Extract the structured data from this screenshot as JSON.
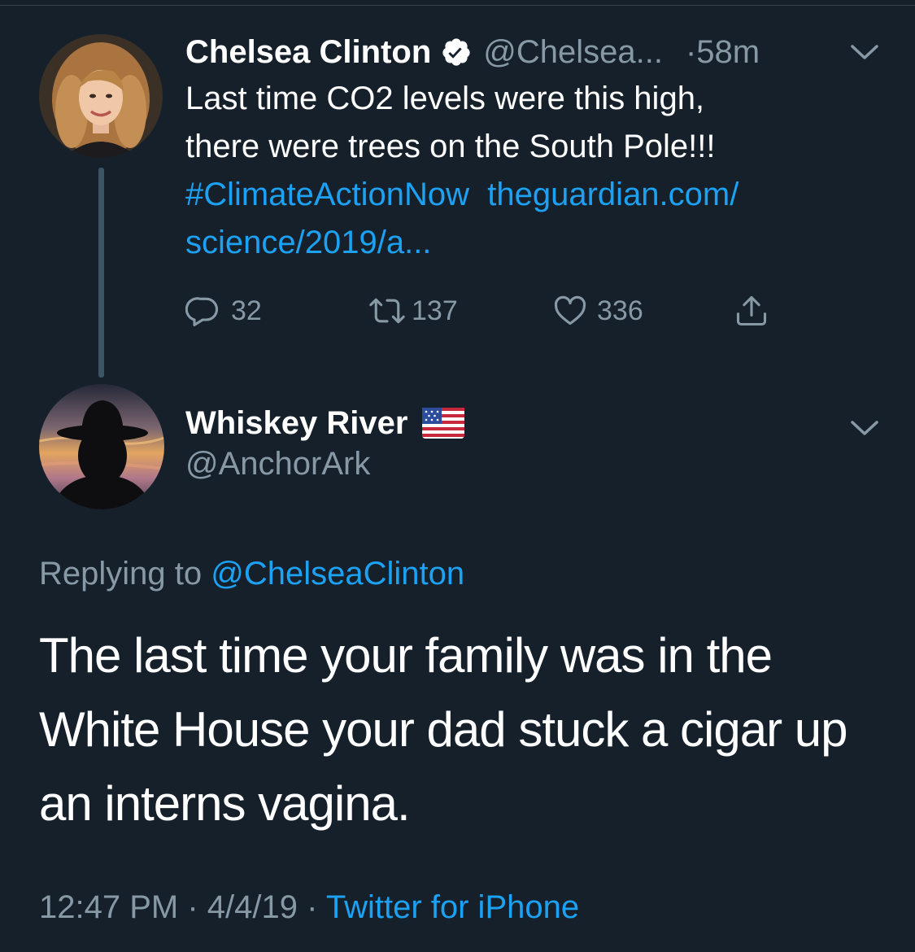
{
  "parent_tweet": {
    "author_name": "Chelsea Clinton",
    "author_handle": "@Chelsea...",
    "dot": "·",
    "time_ago": "58m",
    "text_line1": "Last time CO2 levels were this high,",
    "text_line2": "there were trees on the South Pole!!!",
    "hashtag": "#ClimateActionNow",
    "link_part1": "theguardian.com/",
    "link_part2": "science/2019/a...",
    "reply_count": "32",
    "retweet_count": "137",
    "like_count": "336",
    "icons": [
      "verified-badge-icon",
      "chevron-down-icon",
      "reply-icon",
      "retweet-icon",
      "like-icon",
      "share-icon"
    ]
  },
  "reply_tweet": {
    "author_name": "Whiskey River",
    "author_flag": "us-flag-emoji",
    "author_handle": "@AnchorArk",
    "replying_prefix": "Replying to",
    "replying_to": "@ChelseaClinton",
    "body": "The last time your family was in the White House your dad stuck a cigar up an interns vagina.",
    "time": "12:47 PM",
    "sep1": "·",
    "date": "4/4/19",
    "sep2": "·",
    "source": "Twitter for iPhone"
  },
  "colors": {
    "background": "#15202b",
    "accent": "#1da1f2",
    "secondary_text": "#8899a6",
    "primary_text": "#ffffff",
    "thread_line": "#3d5466"
  }
}
